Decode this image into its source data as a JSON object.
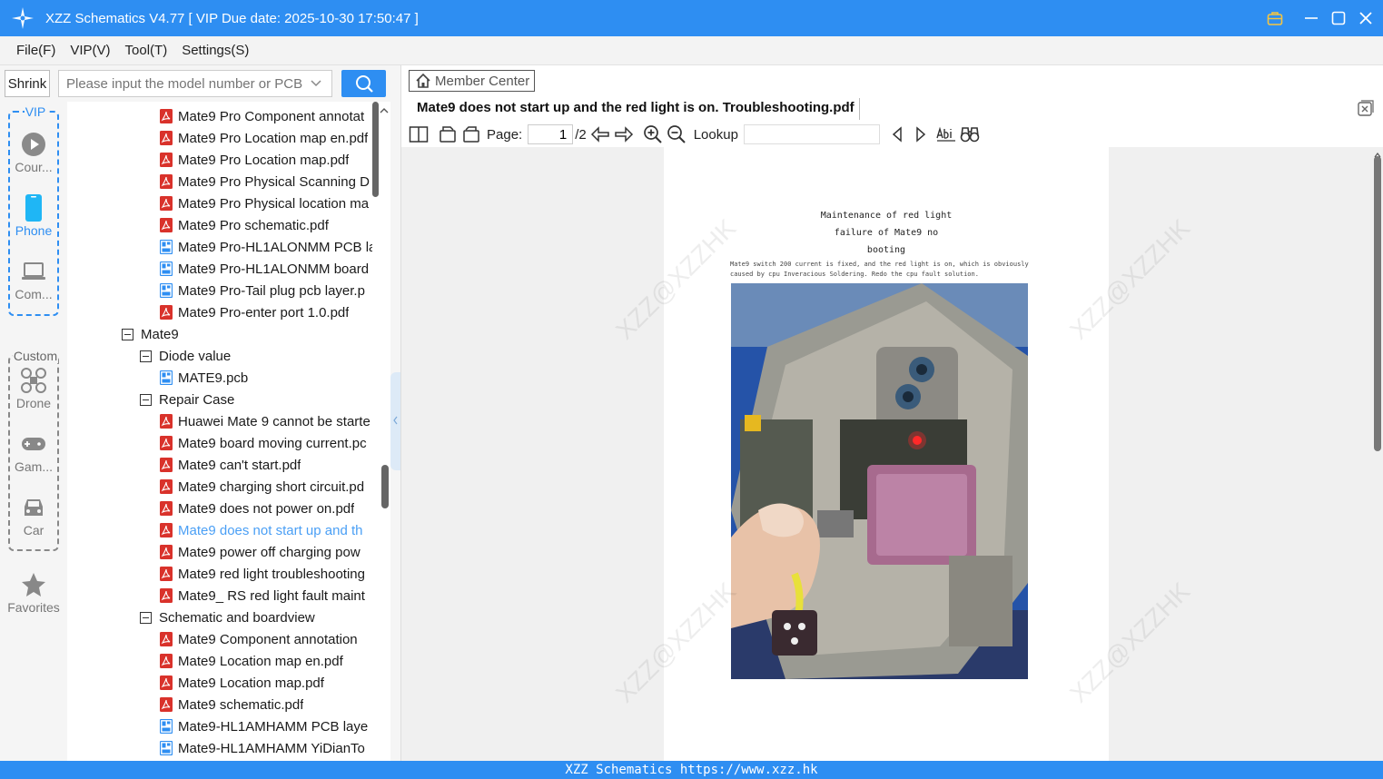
{
  "window": {
    "title": "XZZ Schematics V4.77 [ VIP Due date: 2025-10-30 17:50:47 ]"
  },
  "menu": [
    "File(F)",
    "VIP(V)",
    "Tool(T)",
    "Settings(S)"
  ],
  "search": {
    "shrink_label": "Shrink",
    "placeholder": "Please input the model number or PCB"
  },
  "categories": {
    "vip_group": "VIP",
    "custom_group": "Custom",
    "items": [
      {
        "label": "Cour...",
        "icon": "play-icon"
      },
      {
        "label": "Phone",
        "icon": "phone-icon"
      },
      {
        "label": "Com...",
        "icon": "laptop-icon"
      },
      {
        "label": "Drone",
        "icon": "drone-icon"
      },
      {
        "label": "Gam...",
        "icon": "gamepad-icon"
      },
      {
        "label": "Car",
        "icon": "car-icon"
      },
      {
        "label": "Favorites",
        "icon": "star-icon"
      }
    ]
  },
  "tree": [
    {
      "label": "Mate9 Pro Component annotat",
      "kind": "pdf",
      "level": 2
    },
    {
      "label": "Mate9 Pro Location map en.pdf",
      "kind": "pdf",
      "level": 2
    },
    {
      "label": "Mate9 Pro Location map.pdf",
      "kind": "pdf",
      "level": 2
    },
    {
      "label": "Mate9 Pro Physical Scanning D",
      "kind": "pdf",
      "level": 2
    },
    {
      "label": "Mate9 Pro Physical location ma",
      "kind": "pdf",
      "level": 2
    },
    {
      "label": "Mate9 Pro schematic.pdf",
      "kind": "pdf",
      "level": 2
    },
    {
      "label": "Mate9 Pro-HL1ALONMM PCB la",
      "kind": "pcb",
      "level": 2
    },
    {
      "label": "Mate9 Pro-HL1ALONMM board",
      "kind": "pcb",
      "level": 2
    },
    {
      "label": "Mate9 Pro-Tail plug pcb layer.p",
      "kind": "pcb",
      "level": 2
    },
    {
      "label": "Mate9 Pro-enter port 1.0.pdf",
      "kind": "pdf",
      "level": 2
    },
    {
      "label": "Mate9",
      "kind": "folder",
      "level": 0
    },
    {
      "label": "Diode value",
      "kind": "folder",
      "level": 1
    },
    {
      "label": "MATE9.pcb",
      "kind": "pcb",
      "level": 2
    },
    {
      "label": "Repair Case",
      "kind": "folder",
      "level": 1
    },
    {
      "label": "Huawei Mate 9 cannot be starte",
      "kind": "pdf",
      "level": 2
    },
    {
      "label": "Mate9 board moving current.pc",
      "kind": "pdf",
      "level": 2
    },
    {
      "label": "Mate9 can't start.pdf",
      "kind": "pdf",
      "level": 2
    },
    {
      "label": "Mate9 charging short circuit.pd",
      "kind": "pdf",
      "level": 2
    },
    {
      "label": "Mate9 does not power on.pdf",
      "kind": "pdf",
      "level": 2
    },
    {
      "label": "Mate9 does not start up and th",
      "kind": "pdf",
      "level": 2,
      "selected": true
    },
    {
      "label": "Mate9 power off charging pow",
      "kind": "pdf",
      "level": 2
    },
    {
      "label": "Mate9 red light troubleshooting",
      "kind": "pdf",
      "level": 2
    },
    {
      "label": "Mate9_ RS red light fault maint",
      "kind": "pdf",
      "level": 2
    },
    {
      "label": "Schematic and boardview",
      "kind": "folder",
      "level": 1
    },
    {
      "label": "Mate9 Component annotation",
      "kind": "pdf",
      "level": 2
    },
    {
      "label": "Mate9 Location map en.pdf",
      "kind": "pdf",
      "level": 2
    },
    {
      "label": "Mate9 Location map.pdf",
      "kind": "pdf",
      "level": 2
    },
    {
      "label": "Mate9 schematic.pdf",
      "kind": "pdf",
      "level": 2
    },
    {
      "label": "Mate9-HL1AMHAMM PCB laye",
      "kind": "pcb",
      "level": 2
    },
    {
      "label": "Mate9-HL1AMHAMM YiDianTo",
      "kind": "pcb",
      "level": 2
    }
  ],
  "viewer": {
    "member_center": "Member Center",
    "doc_title": "Mate9 does not start up and the red light is on. Troubleshooting.pdf",
    "page_label": "Page:",
    "page_current": "1",
    "page_total": "/2",
    "lookup_label": "Lookup",
    "doc_heading": [
      "Maintenance of red light",
      "failure of Mate9 no",
      "booting"
    ],
    "doc_body": [
      "Mate9 switch 200 current is fixed, and the red light is on, which is obviously",
      "caused by cpu Inveracious  Soldering. Redo the cpu fault solution."
    ],
    "watermark": "XZZ@XZZHK"
  },
  "status_bar": "XZZ Schematics https://www.xzz.hk",
  "colors": {
    "accent": "#2e8ef2",
    "pdf_icon": "#d9322b",
    "pcb_icon": "#2e8ef2",
    "selected_text": "#4a9ff5"
  }
}
